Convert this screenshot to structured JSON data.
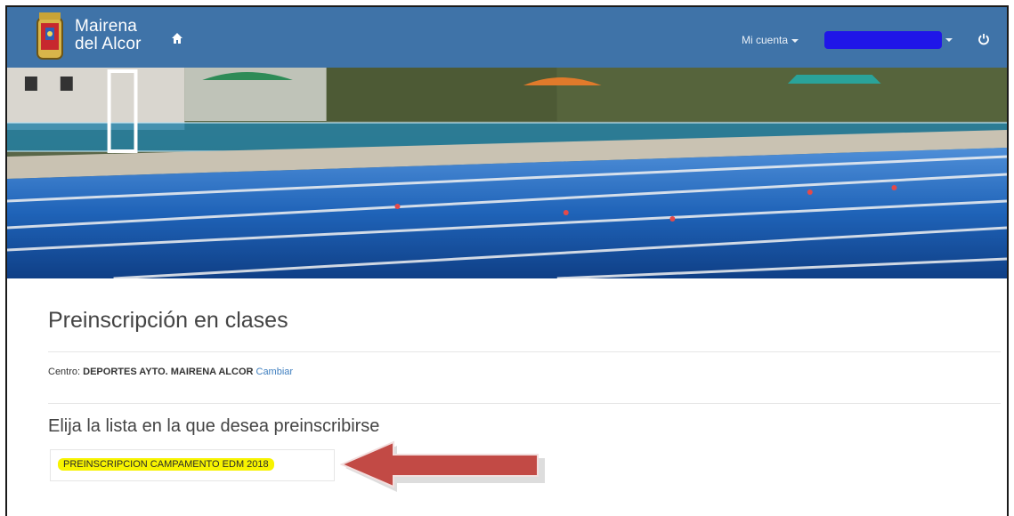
{
  "navbar": {
    "brand_line1": "Mairena",
    "brand_line2": "del Alcor",
    "account_label": "Mi cuenta",
    "icons": [
      "crest-logo",
      "home-icon",
      "power-icon"
    ],
    "background_color": "#3f73a8"
  },
  "main": {
    "title": "Preinscripción en clases",
    "centro_label": "Centro:",
    "centro_name": "DEPORTES AYTO. MAIRENA ALCOR",
    "centro_change_link": "Cambiar",
    "subtitle": "Elija la lista en la que desea preinscribirse",
    "list_items": [
      {
        "label": "PREINSCRIPCION CAMPAMENTO EDM 2018"
      }
    ]
  },
  "annotation": {
    "arrow_color": "#c24a45",
    "highlight_color": "#f7f300"
  }
}
